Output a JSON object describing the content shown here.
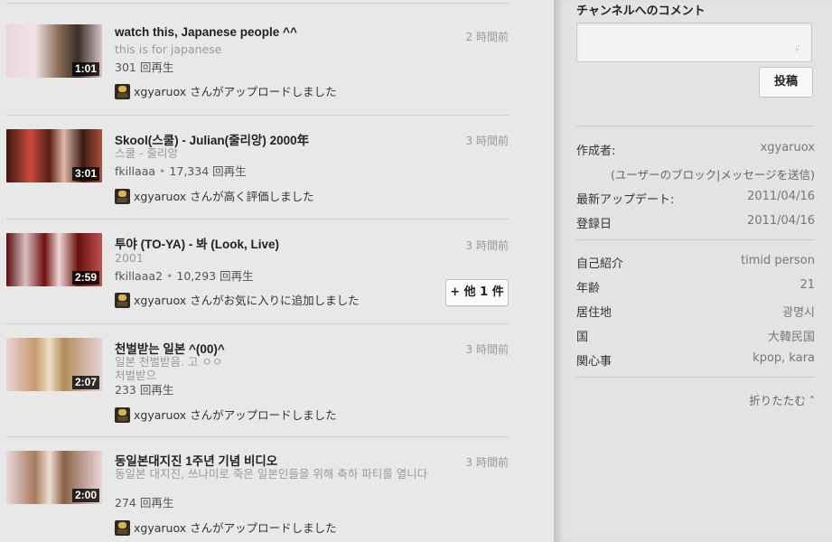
{
  "feed": {
    "items": [
      {
        "title": "watch this, Japanese people ^^",
        "desc": "this is for japanese",
        "uploader": "",
        "views": "301 回再生",
        "time": "2 時間前",
        "duration": "1:01",
        "activity": "xgyaruox さんがアップロードしました"
      },
      {
        "title": "Skool(스쿨) - Julian(줄리앙) 2000年",
        "desc": "스쿨 - 줄리앙",
        "uploader": "fkillaaa",
        "views": "17,334 回再生",
        "time": "3 時間前",
        "duration": "3:01",
        "activity": "xgyaruox さんが高く評価しました"
      },
      {
        "title": "투야 (TO-YA) - 봐 (Look, Live)",
        "desc": "2001",
        "uploader": "fkillaaa2",
        "views": "10,293 回再生",
        "time": "3 時間前",
        "duration": "2:59",
        "activity": "xgyaruox さんがお気に入りに追加しました",
        "more_label": "+ 他 1 件"
      },
      {
        "title": "천벌받는 일본 ^(00)^",
        "desc": "일본 천벌받음. 고 ㅇㅇ 처벌받으",
        "uploader": "",
        "views": "233 回再生",
        "time": "3 時間前",
        "duration": "2:07",
        "activity": "xgyaruox さんがアップロードしました"
      },
      {
        "title": "동일본대지진 1주년 기념 비디오",
        "desc": "동일본 대지진, 쓰나미로 죽은 일본인들을 위해 축하 파티를 열니다",
        "uploader": "",
        "views": "274 回再生",
        "time": "3 時間前",
        "duration": "2:00",
        "activity": "xgyaruox さんがアップロードしました"
      }
    ]
  },
  "side": {
    "comment_heading": "チャンネルへのコメント",
    "comment_placeholder": "",
    "post_label": "投稿",
    "creator_key": "作成者:",
    "creator_value": "xgyaruox",
    "block_links": "(ユーザーのブロック|メッセージを送信)",
    "updated_key": "最新アップデート:",
    "updated_value": "2011/04/16",
    "joined_key": "登録日",
    "joined_value": "2011/04/16",
    "about_key": "自己紹介",
    "about_value": "timid person",
    "age_key": "年齢",
    "age_value": "21",
    "location_key": "居住地",
    "location_value": "광명시",
    "country_key": "国",
    "country_value": "大韓民国",
    "interests_key": "関心事",
    "interests_value": "kpop, kara",
    "collapse_label": "折りたたむ ˄"
  },
  "colors": {
    "feed_bg": "#e8e8e8",
    "side_bg": "#e3e3e3",
    "duration_badge": "#000000"
  }
}
